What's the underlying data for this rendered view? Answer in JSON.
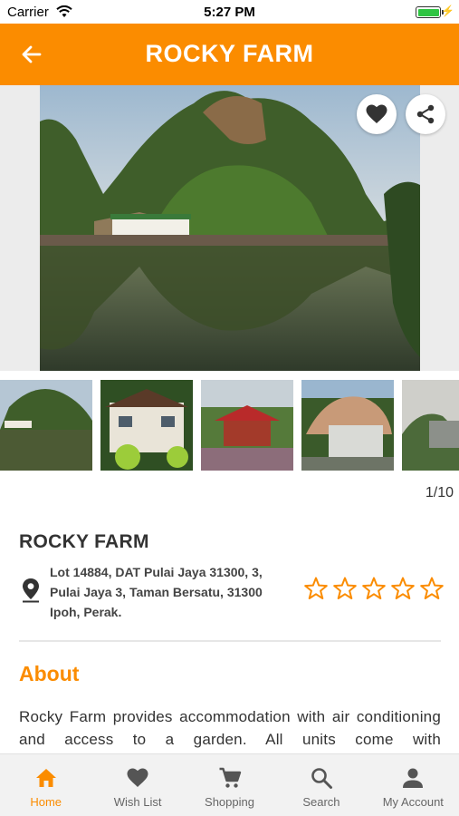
{
  "status_bar": {
    "carrier": "Carrier",
    "time": "5:27 PM"
  },
  "header": {
    "title": "ROCKY FARM",
    "back_icon": "arrow-left-icon"
  },
  "hero": {
    "like_icon": "heart-icon",
    "share_icon": "share-icon"
  },
  "gallery": {
    "counter": "1/10"
  },
  "details": {
    "name": "ROCKY FARM",
    "address": "Lot 14884, DAT Pulai Jaya 31300, 3, Pulai Jaya 3, Taman Bersatu, 31300 Ipoh, Perak.",
    "rating": 0,
    "max_rating": 5
  },
  "about": {
    "title": "About",
    "text": "Rocky Farm provides accommodation with air conditioning and access to a garden. All units come with"
  },
  "nav": {
    "items": [
      {
        "label": "Home",
        "icon": "home-icon",
        "active": true
      },
      {
        "label": "Wish List",
        "icon": "heart-icon",
        "active": false
      },
      {
        "label": "Shopping",
        "icon": "cart-icon",
        "active": false
      },
      {
        "label": "Search",
        "icon": "search-icon",
        "active": false
      },
      {
        "label": "My Account",
        "icon": "person-icon",
        "active": false
      }
    ]
  },
  "colors": {
    "accent": "#fb8c00",
    "text": "#333333"
  }
}
